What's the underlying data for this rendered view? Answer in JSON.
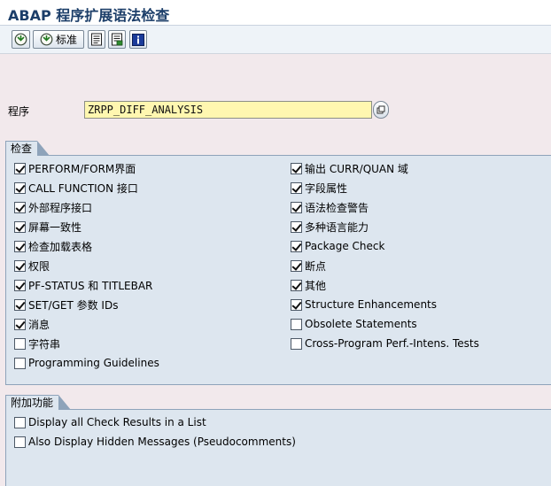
{
  "window": {
    "title": "ABAP 程序扩展语法检查"
  },
  "toolbar": {
    "execute_icon": "execute-icon",
    "standard_label": "标准",
    "standard_icon": "execute-variant-icon",
    "buttons": [
      "list-display-icon",
      "list-settings-icon",
      "info-icon"
    ]
  },
  "program": {
    "label": "程序",
    "value": "ZRPP_DIFF_ANALYSIS",
    "help_icon": "value-help-icon"
  },
  "checks": {
    "title": "检查",
    "left": [
      {
        "label": "PERFORM/FORM界面",
        "checked": true
      },
      {
        "label": "CALL FUNCTION 接口",
        "checked": true
      },
      {
        "label": "外部程序接口",
        "checked": true
      },
      {
        "label": "屏幕一致性",
        "checked": true
      },
      {
        "label": "检查加载表格",
        "checked": true
      },
      {
        "label": "权限",
        "checked": true
      },
      {
        "label": "PF-STATUS 和 TITLEBAR",
        "checked": true
      },
      {
        "label": "SET/GET  参数 IDs",
        "checked": true
      },
      {
        "label": "消息",
        "checked": true
      },
      {
        "label": "字符串",
        "checked": false
      },
      {
        "label": "Programming Guidelines",
        "checked": false
      }
    ],
    "right": [
      {
        "label": "输出 CURR/QUAN 域",
        "checked": true
      },
      {
        "label": "字段属性",
        "checked": true
      },
      {
        "label": "语法检查警告",
        "checked": true
      },
      {
        "label": "多种语言能力",
        "checked": true
      },
      {
        "label": "Package Check",
        "checked": true
      },
      {
        "label": "断点",
        "checked": true
      },
      {
        "label": "其他",
        "checked": true
      },
      {
        "label": "Structure Enhancements",
        "checked": true
      },
      {
        "label": "Obsolete Statements",
        "checked": false
      },
      {
        "label": "Cross-Program Perf.-Intens. Tests",
        "checked": false
      }
    ]
  },
  "additional": {
    "title": "附加功能",
    "items": [
      {
        "label": "Display all Check Results in a List",
        "checked": false
      },
      {
        "label": "Also Display Hidden Messages (Pseudocomments)",
        "checked": false
      }
    ]
  },
  "colors": {
    "title": "#1c3e69",
    "group_bg": "#dde6ef",
    "input_bg": "#fff7b0",
    "page_bg": "#f2e9ec"
  }
}
